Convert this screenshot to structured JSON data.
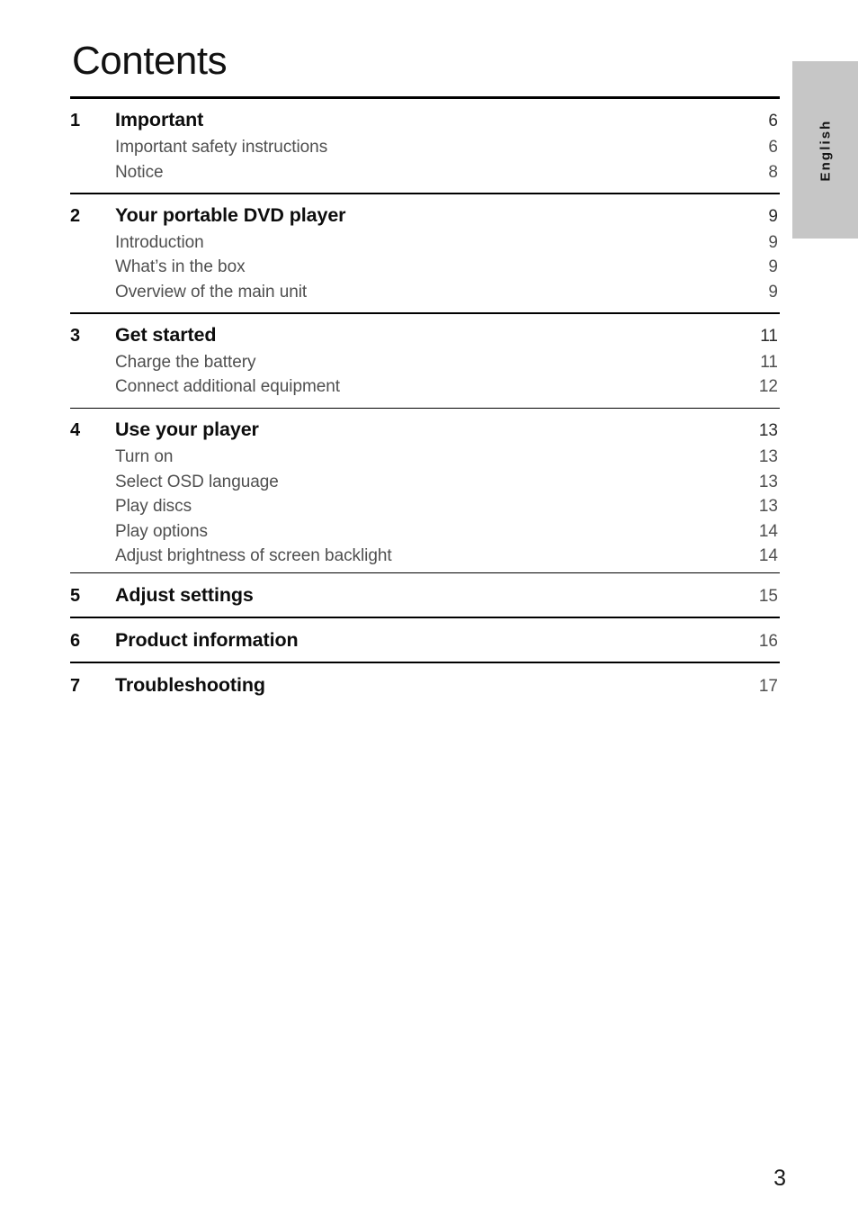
{
  "document": {
    "page_title": "Contents",
    "folio": "3",
    "side_tab": {
      "label": "English",
      "background_color": "#c6c6c6"
    }
  },
  "toc": {
    "groups": [
      {
        "number": "1",
        "title": "Important",
        "page": "6",
        "entries": [
          {
            "label": "Important safety instructions",
            "page": "6"
          },
          {
            "label": "Notice",
            "page": "8"
          }
        ]
      },
      {
        "number": "2",
        "title": "Your portable DVD player",
        "page": "9",
        "entries": [
          {
            "label": "Introduction",
            "page": "9"
          },
          {
            "label": "What’s in the box",
            "page": "9"
          },
          {
            "label": "Overview of the main unit",
            "page": "9"
          }
        ]
      },
      {
        "number": "3",
        "title": "Get started",
        "page": "11",
        "entries": [
          {
            "label": "Charge the battery",
            "page": "11"
          },
          {
            "label": "Connect additional equipment",
            "page": "12"
          }
        ]
      },
      {
        "number": "4",
        "title": "Use your player",
        "page": "13",
        "entries": [
          {
            "label": "Turn on",
            "page": "13"
          },
          {
            "label": "Select OSD language",
            "page": "13"
          },
          {
            "label": "Play discs",
            "page": "13"
          },
          {
            "label": "Play options",
            "page": "14"
          },
          {
            "label": "Adjust brightness of screen backlight",
            "page": "14"
          }
        ]
      },
      {
        "number": "5",
        "title": "Adjust settings",
        "page": "15",
        "entries": []
      },
      {
        "number": "6",
        "title": "Product information",
        "page": "16",
        "entries": []
      },
      {
        "number": "7",
        "title": "Troubleshooting",
        "page": "17",
        "entries": []
      }
    ]
  }
}
